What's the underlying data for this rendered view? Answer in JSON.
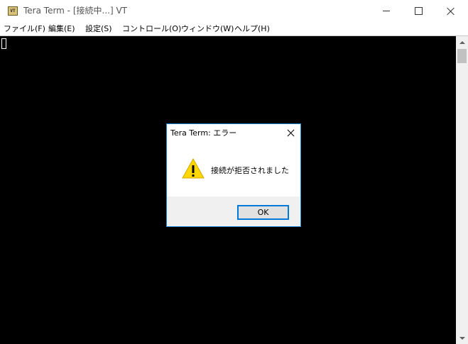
{
  "window": {
    "title": "Tera Term - [接続中...] VT",
    "icon": "tera-term-vt-icon",
    "icon_text": "VT"
  },
  "menu": {
    "items": [
      {
        "label": "ファイル(F)"
      },
      {
        "label": "編集(E)"
      },
      {
        "label": "設定(S)"
      },
      {
        "label": "コントロール(O)"
      },
      {
        "label": "ウィンドウ(W)"
      },
      {
        "label": "ヘルプ(H)"
      }
    ]
  },
  "dialog": {
    "title": "Tera Term: エラー",
    "icon": "warning-icon",
    "message": "接続が拒否されました",
    "ok_label": "OK"
  },
  "colors": {
    "terminal_background": "#000000",
    "dialog_border": "#1883d7",
    "button_focus_border": "#0078d7",
    "warning_yellow": "#ffd700"
  }
}
